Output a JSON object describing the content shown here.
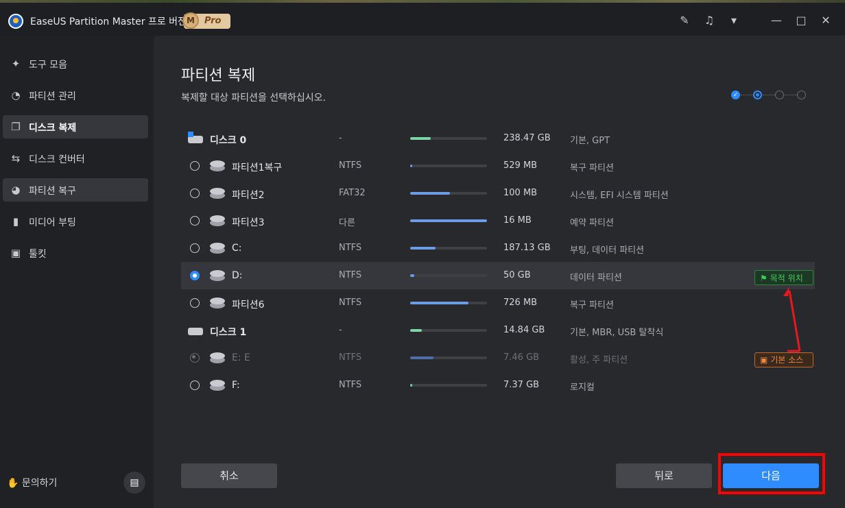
{
  "titlebar": {
    "app_title": "EaseUS Partition Master 프로 버전",
    "badge_letter": "M",
    "badge_text": "Pro",
    "icons": [
      "notes-icon",
      "bell-icon",
      "dropdown-box-icon",
      "minimize-icon",
      "maximize-icon",
      "close-icon"
    ]
  },
  "sidebar": {
    "items": [
      {
        "label": "도구 모음",
        "icon": "toolbox-icon"
      },
      {
        "label": "파티션 관리",
        "icon": "partition-manage-icon"
      },
      {
        "label": "디스크 복제",
        "icon": "disk-clone-icon"
      },
      {
        "label": "디스크 컨버터",
        "icon": "disk-converter-icon"
      },
      {
        "label": "파티션 복구",
        "icon": "partition-recovery-icon"
      },
      {
        "label": "미디어 부팅",
        "icon": "usb-boot-icon"
      },
      {
        "label": "툴킷",
        "icon": "toolkit-icon"
      }
    ],
    "active_index": 2,
    "help_label": "문의하기"
  },
  "main": {
    "title": "파티션 복제",
    "subtitle": "복제할 대상 파티션을 선택하십시오.",
    "steps": {
      "total": 4,
      "current": 2
    },
    "rows": [
      {
        "type": "disk",
        "name": "디스크 0",
        "fs": "-",
        "usage": 0.27,
        "size": "238.47 GB",
        "desc": "기본, GPT",
        "bar_color": "#7fd3a8"
      },
      {
        "type": "part",
        "name": "파티션1복구",
        "fs": "NTFS",
        "usage": 0.02,
        "size": "529 MB",
        "desc": "복구 파티션",
        "bar_color": "#6d9be6"
      },
      {
        "type": "part",
        "name": "파티션2",
        "fs": "FAT32",
        "usage": 0.52,
        "size": "100 MB",
        "desc": "시스템, EFI 시스템 파티션",
        "bar_color": "#6d9be6"
      },
      {
        "type": "part",
        "name": "파티션3",
        "fs": "다른",
        "usage": 1.0,
        "size": "16 MB",
        "desc": "예약 파티션",
        "bar_color": "#6d9be6"
      },
      {
        "type": "part",
        "name": "C:",
        "fs": "NTFS",
        "usage": 0.33,
        "size": "187.13 GB",
        "desc": "부팅, 데이터 파티션",
        "bar_color": "#6d9be6"
      },
      {
        "type": "part",
        "name": "D:",
        "fs": "NTFS",
        "usage": 0.05,
        "size": "50 GB",
        "desc": "데이터 파티션",
        "bar_color": "#6d9be6",
        "checked": true
      },
      {
        "type": "part",
        "name": "파티션6",
        "fs": "NTFS",
        "usage": 0.76,
        "size": "726 MB",
        "desc": "복구 파티션",
        "bar_color": "#6d9be6"
      },
      {
        "type": "disk",
        "name": "디스크 1",
        "fs": "-",
        "usage": 0.15,
        "size": "14.84 GB",
        "desc": "기본, MBR, USB 탈착식",
        "bar_color": "#7fd3a8"
      },
      {
        "type": "part",
        "name": "E: E",
        "fs": "NTFS",
        "usage": 0.3,
        "size": "7.46 GB",
        "desc": "활성, 주 파티션",
        "bar_color": "#4e6ea8",
        "disabled": true
      },
      {
        "type": "part",
        "name": "F:",
        "fs": "NTFS",
        "usage": 0.02,
        "size": "7.37 GB",
        "desc": "로지컬",
        "bar_color": "#7fd3a8"
      }
    ],
    "tag_target": "목적 위치",
    "tag_source": "기본 소스",
    "cancel_label": "취소",
    "back_label": "뒤로",
    "next_label": "다음"
  },
  "colors": {
    "accent": "#2f8cff",
    "highlight": "#ff0000",
    "target_tag": "#3fd05a",
    "source_tag": "#f08a3c"
  }
}
